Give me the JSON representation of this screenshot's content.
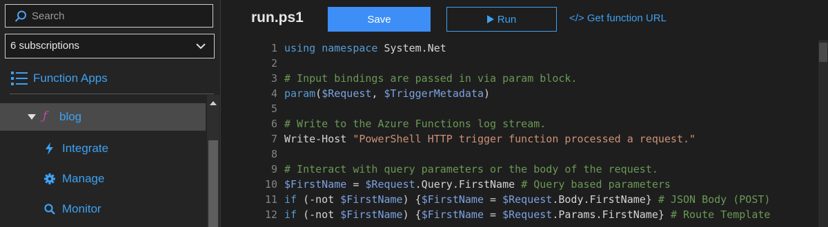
{
  "sidebar": {
    "search_placeholder": "Search",
    "subscriptions_label": "6 subscriptions",
    "function_apps_label": "Function Apps",
    "app": {
      "name": "blog",
      "icon": "function-icon"
    },
    "items": [
      {
        "label": "Integrate",
        "icon": "lightning-icon"
      },
      {
        "label": "Manage",
        "icon": "gear-icon"
      },
      {
        "label": "Monitor",
        "icon": "search-icon"
      }
    ]
  },
  "toolbar": {
    "file_name": "run.ps1",
    "save_label": "Save",
    "run_label": "Run",
    "get_url_label": "</> Get function URL"
  },
  "colors": {
    "accent": "#3ea1f2",
    "save_button": "#3d8ef7",
    "keyword": "#569cd6",
    "comment": "#6a9955",
    "string": "#ce9178",
    "variable": "#7ca2e0"
  },
  "editor": {
    "lines": [
      {
        "n": "1",
        "tokens": [
          {
            "t": "using",
            "c": "kw"
          },
          {
            "t": " ",
            "c": "pl"
          },
          {
            "t": "namespace",
            "c": "kw"
          },
          {
            "t": " System.Net",
            "c": "pl"
          }
        ]
      },
      {
        "n": "2",
        "tokens": []
      },
      {
        "n": "3",
        "tokens": [
          {
            "t": "# Input bindings are passed in via param block.",
            "c": "cm"
          }
        ]
      },
      {
        "n": "4",
        "tokens": [
          {
            "t": "param",
            "c": "kw"
          },
          {
            "t": "(",
            "c": "pl"
          },
          {
            "t": "$Request",
            "c": "var"
          },
          {
            "t": ", ",
            "c": "pl"
          },
          {
            "t": "$TriggerMetadata",
            "c": "var"
          },
          {
            "t": ")",
            "c": "pl"
          }
        ]
      },
      {
        "n": "5",
        "tokens": []
      },
      {
        "n": "6",
        "tokens": [
          {
            "t": "# Write to the Azure Functions log stream.",
            "c": "cm"
          }
        ]
      },
      {
        "n": "7",
        "tokens": [
          {
            "t": "Write-Host ",
            "c": "pl"
          },
          {
            "t": "\"PowerShell HTTP trigger function processed a request.\"",
            "c": "str"
          }
        ]
      },
      {
        "n": "8",
        "tokens": []
      },
      {
        "n": "9",
        "tokens": [
          {
            "t": "# Interact with query parameters or the body of the request.",
            "c": "cm"
          }
        ]
      },
      {
        "n": "10",
        "tokens": [
          {
            "t": "$FirstName",
            "c": "var"
          },
          {
            "t": " = ",
            "c": "pl"
          },
          {
            "t": "$Request",
            "c": "var"
          },
          {
            "t": ".Query.FirstName ",
            "c": "pl"
          },
          {
            "t": "# Query based parameters",
            "c": "cm"
          }
        ]
      },
      {
        "n": "11",
        "tokens": [
          {
            "t": "if",
            "c": "kw"
          },
          {
            "t": " (-not ",
            "c": "pl"
          },
          {
            "t": "$FirstName",
            "c": "var"
          },
          {
            "t": ") {",
            "c": "pl"
          },
          {
            "t": "$FirstName",
            "c": "var"
          },
          {
            "t": " = ",
            "c": "pl"
          },
          {
            "t": "$Request",
            "c": "var"
          },
          {
            "t": ".Body.FirstName} ",
            "c": "pl"
          },
          {
            "t": "# JSON Body (POST)",
            "c": "cm"
          }
        ]
      },
      {
        "n": "12",
        "tokens": [
          {
            "t": "if",
            "c": "kw"
          },
          {
            "t": " (-not ",
            "c": "pl"
          },
          {
            "t": "$FirstName",
            "c": "var"
          },
          {
            "t": ") {",
            "c": "pl"
          },
          {
            "t": "$FirstName",
            "c": "var"
          },
          {
            "t": " = ",
            "c": "pl"
          },
          {
            "t": "$Request",
            "c": "var"
          },
          {
            "t": ".Params.FirstName} ",
            "c": "pl"
          },
          {
            "t": "# Route Template",
            "c": "cm"
          }
        ]
      }
    ]
  }
}
